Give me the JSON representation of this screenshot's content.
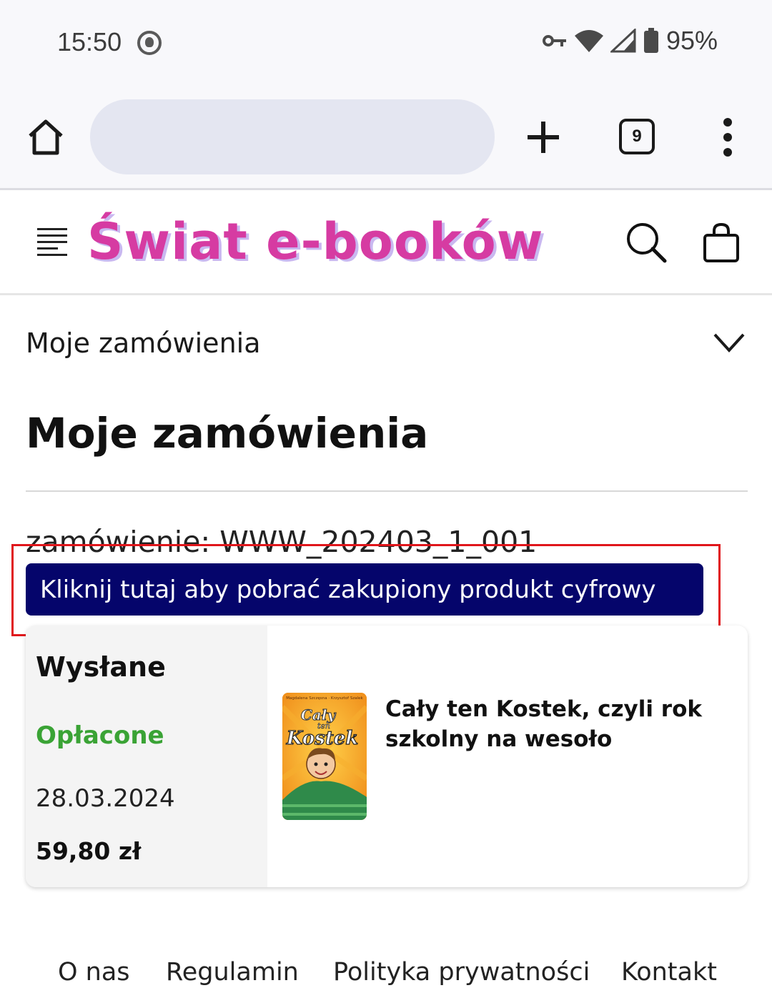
{
  "status_bar": {
    "time": "15:50",
    "battery": "95%",
    "icons": [
      "app-notification-icon",
      "vpn-key-icon",
      "wifi-icon",
      "signal-icon",
      "battery-icon"
    ]
  },
  "browser": {
    "tab_count": "9",
    "icons": [
      "home-icon",
      "plus-icon",
      "tabs-icon",
      "more-vert-icon"
    ]
  },
  "site": {
    "logo": "Świat e-booków",
    "logo_color": "#d63ba2",
    "icons": [
      "hamburger-menu-icon",
      "search-icon",
      "shopping-bag-icon"
    ]
  },
  "account_menu": {
    "label": "Moje zamówienia"
  },
  "page": {
    "title": "Moje zamówienia"
  },
  "order": {
    "number": "zamówienie: WWW_202403_1_001",
    "download_button": "Kliknij tutaj aby pobrać zakupiony produkt cyfrowy",
    "download_button_color": "#05056b",
    "status": "Wysłane",
    "payment_status": "Opłacone",
    "payment_status_color": "#3aa335",
    "date": "28.03.2024",
    "total": "59,80 zł",
    "items": [
      {
        "title": "Cały ten Kostek, czyli rok szkolny na wesoło",
        "cover_authors": "Magdalena Szczęsna · Krzysztof Szalek",
        "cover_title_1": "Cały",
        "cover_title_2": "ten",
        "cover_title_3": "Kostek"
      }
    ]
  },
  "footer": {
    "links": [
      "O nas",
      "Regulamin",
      "Polityka prywatności",
      "Kontakt"
    ]
  },
  "highlight_color": "#e0161b"
}
